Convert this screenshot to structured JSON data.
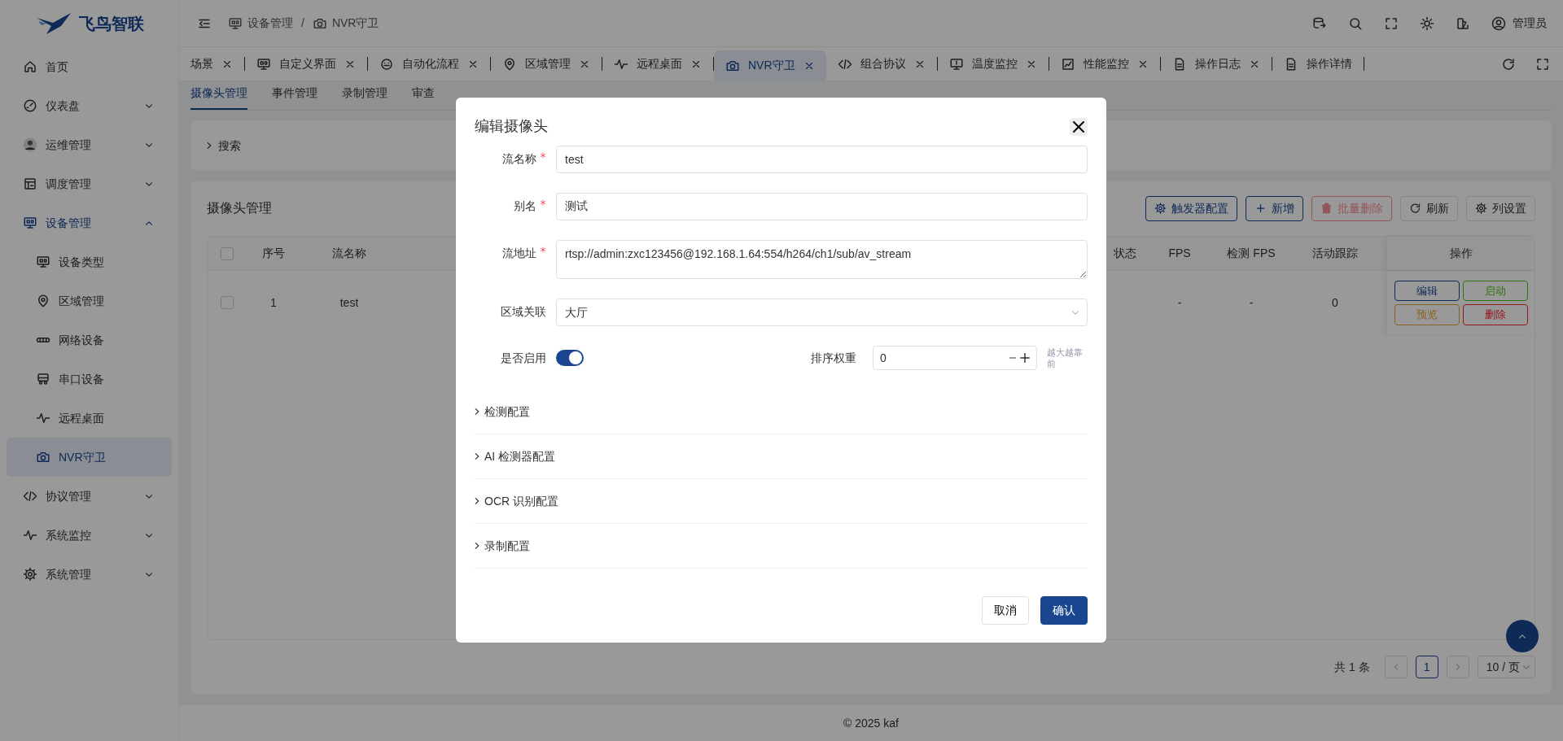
{
  "app": {
    "logo_text": "飞鸟智联"
  },
  "sidebar": {
    "items": [
      {
        "label": "首页",
        "selected": false
      },
      {
        "label": "仪表盘",
        "expanded": false,
        "selected": false
      },
      {
        "label": "运维管理",
        "expanded": false,
        "selected": false
      },
      {
        "label": "调度管理",
        "expanded": false,
        "selected": false
      },
      {
        "label": "设备管理",
        "expanded": true,
        "selected": false,
        "children": [
          {
            "label": "设备类型",
            "selected": false
          },
          {
            "label": "区域管理",
            "selected": false
          },
          {
            "label": "网络设备",
            "selected": false
          },
          {
            "label": "串口设备",
            "selected": false
          },
          {
            "label": "远程桌面",
            "selected": false
          },
          {
            "label": "NVR守卫",
            "selected": true
          }
        ]
      },
      {
        "label": "协议管理",
        "expanded": false,
        "selected": false
      },
      {
        "label": "系统监控",
        "expanded": false,
        "selected": false
      },
      {
        "label": "系统管理",
        "expanded": false,
        "selected": false
      }
    ]
  },
  "header": {
    "breadcrumb": {
      "separator": "/",
      "items": [
        {
          "label": "设备管理"
        },
        {
          "label": "NVR守卫"
        }
      ]
    },
    "user": {
      "name": "管理员"
    }
  },
  "tabs": [
    {
      "label": "场景",
      "selected": false,
      "closable": true
    },
    {
      "label": "自定义界面",
      "selected": false,
      "closable": true
    },
    {
      "label": "自动化流程",
      "selected": false,
      "closable": true
    },
    {
      "label": "区域管理",
      "selected": false,
      "closable": true
    },
    {
      "label": "远程桌面",
      "selected": false,
      "closable": true
    },
    {
      "label": "NVR守卫",
      "selected": true,
      "closable": true
    },
    {
      "label": "组合协议",
      "selected": false,
      "closable": true
    },
    {
      "label": "温度监控",
      "selected": false,
      "closable": true
    },
    {
      "label": "性能监控",
      "selected": false,
      "closable": true
    },
    {
      "label": "操作日志",
      "selected": false,
      "closable": true
    },
    {
      "label": "操作详情",
      "selected": false,
      "closable": false
    }
  ],
  "page_tabs": [
    {
      "label": "摄像头管理",
      "selected": true
    },
    {
      "label": "事件管理",
      "selected": false
    },
    {
      "label": "录制管理",
      "selected": false
    },
    {
      "label": "审查",
      "selected": false
    }
  ],
  "search": {
    "label": "搜索",
    "expanded": false
  },
  "table_card": {
    "title": "摄像头管理",
    "toolbar": [
      {
        "label": "触发器配置",
        "kind": "primary",
        "disabled": false
      },
      {
        "label": "新增",
        "kind": "primary",
        "disabled": false
      },
      {
        "label": "批量删除",
        "kind": "danger",
        "disabled": true
      },
      {
        "label": "刷新",
        "kind": "default",
        "disabled": false
      },
      {
        "label": "列设置",
        "kind": "default",
        "disabled": false
      }
    ],
    "columns": {
      "index": "序号",
      "stream_name": "流名称",
      "status": "状态",
      "fps": "FPS",
      "detect_fps": "检测 FPS",
      "tracking": "活动跟踪",
      "actions": "操作"
    },
    "header_checked": false,
    "rows": [
      {
        "checked": false,
        "index": "1",
        "stream_name": "test",
        "fps": "-",
        "detect_fps": "-",
        "tracking": "0",
        "actions": [
          {
            "label": "编辑",
            "kind": "edit"
          },
          {
            "label": "启动",
            "kind": "start"
          },
          {
            "label": "预览",
            "kind": "preview"
          },
          {
            "label": "删除",
            "kind": "delete"
          }
        ]
      }
    ],
    "pagination": {
      "total": "共 1 条",
      "pages": [
        {
          "label": "1",
          "selected": true
        }
      ],
      "page_size": "10 / 页"
    }
  },
  "footer": "© 2025 kaf",
  "modal": {
    "title": "编辑摄像头",
    "fields": [
      {
        "kind": "input",
        "label": "流名称",
        "required": true,
        "value": "test"
      },
      {
        "kind": "input",
        "label": "别名",
        "required": true,
        "value": "测试"
      },
      {
        "kind": "textarea",
        "label": "流地址",
        "required": true,
        "value": "rtsp://admin:zxc123456@192.168.1.64:554/h264/ch1/sub/av_stream"
      },
      {
        "kind": "select",
        "label": "区域关联",
        "required": false,
        "value": "大厅"
      }
    ],
    "enabled": {
      "label": "是否启用",
      "on": true
    },
    "sort": {
      "label": "排序权重",
      "value": "0",
      "hint": "越大越靠前"
    },
    "sections": [
      {
        "label": "检测配置",
        "expanded": false
      },
      {
        "label": "AI 检测器配置",
        "expanded": false
      },
      {
        "label": "OCR 识别配置",
        "expanded": false
      },
      {
        "label": "录制配置",
        "expanded": false
      }
    ],
    "buttons": [
      {
        "label": "取消",
        "kind": "default"
      },
      {
        "label": "确认",
        "kind": "primary"
      }
    ]
  }
}
